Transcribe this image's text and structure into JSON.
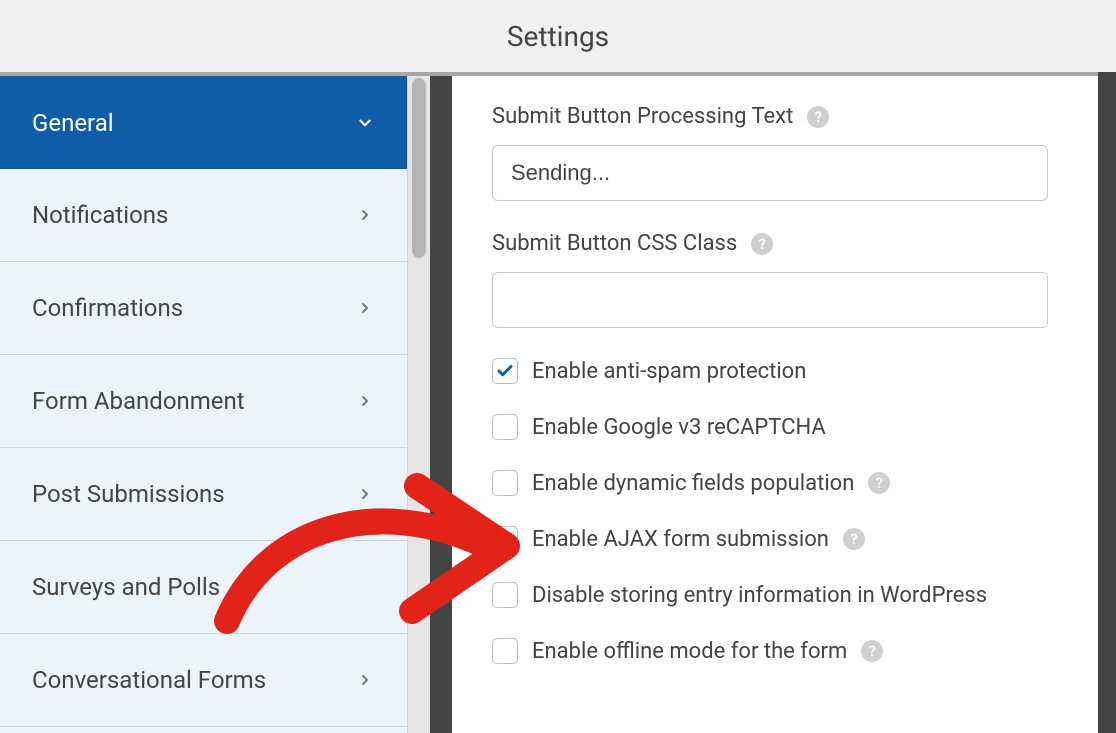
{
  "header": {
    "title": "Settings"
  },
  "sidebar": {
    "items": [
      {
        "label": "General",
        "active": true,
        "expand": "down"
      },
      {
        "label": "Notifications",
        "active": false,
        "expand": "right"
      },
      {
        "label": "Confirmations",
        "active": false,
        "expand": "right"
      },
      {
        "label": "Form Abandonment",
        "active": false,
        "expand": "right"
      },
      {
        "label": "Post Submissions",
        "active": false,
        "expand": "right"
      },
      {
        "label": "Surveys and Polls",
        "active": false,
        "expand": "none"
      },
      {
        "label": "Conversational Forms",
        "active": false,
        "expand": "right"
      }
    ]
  },
  "main": {
    "fields": {
      "processing_text": {
        "label": "Submit Button Processing Text",
        "value": "Sending...",
        "help": true
      },
      "css_class": {
        "label": "Submit Button CSS Class",
        "value": "",
        "help": true
      }
    },
    "checkboxes": [
      {
        "label": "Enable anti-spam protection",
        "checked": true,
        "help": false
      },
      {
        "label": "Enable Google v3 reCAPTCHA",
        "checked": false,
        "help": false
      },
      {
        "label": "Enable dynamic fields population",
        "checked": false,
        "help": true
      },
      {
        "label": "Enable AJAX form submission",
        "checked": true,
        "help": true
      },
      {
        "label": "Disable storing entry information in WordPress",
        "checked": false,
        "help": false
      },
      {
        "label": "Enable offline mode for the form",
        "checked": false,
        "help": true
      }
    ]
  },
  "colors": {
    "accent": "#0f5da7",
    "check": "#0f5da7",
    "arrow": "#e2231a"
  }
}
